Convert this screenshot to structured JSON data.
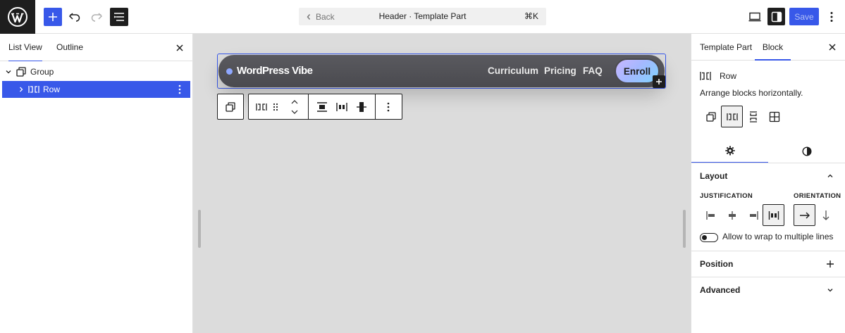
{
  "topbar": {
    "back_label": "Back",
    "document_title": "Header · Template Part",
    "shortcut": "⌘K",
    "save_label": "Save",
    "icons": [
      "wordpress-logo-icon",
      "plus-icon",
      "undo-icon",
      "redo-icon",
      "document-overview-icon",
      "desktop-view-icon",
      "settings-sidebar-icon",
      "options-icon"
    ]
  },
  "left_panel": {
    "tabs": [
      {
        "label": "List View",
        "active": true
      },
      {
        "label": "Outline",
        "active": false
      }
    ],
    "tree": [
      {
        "label": "Group",
        "icon": "group-icon",
        "expanded": true,
        "selected": false
      },
      {
        "label": "Row",
        "icon": "row-icon",
        "expanded": false,
        "selected": true
      }
    ]
  },
  "canvas": {
    "site_title": "WordPress Vibe",
    "nav_links": [
      "Curriculum",
      "Pricing",
      "FAQ"
    ],
    "cta_label": "Enroll"
  },
  "right_panel": {
    "tabs": [
      {
        "label": "Template Part",
        "active": false
      },
      {
        "label": "Block",
        "active": true
      }
    ],
    "block_name": "Row",
    "block_description": "Arrange blocks horizontally.",
    "variations": [
      "group-icon",
      "row-icon",
      "stack-icon",
      "grid-icon"
    ],
    "active_variation": "row-icon",
    "layout": {
      "title": "Layout",
      "justification_label": "Justification",
      "orientation_label": "Orientation",
      "justification_options": [
        "justify-left-icon",
        "justify-center-icon",
        "justify-right-icon",
        "justify-space-between-icon"
      ],
      "justification_selected": "justify-space-between-icon",
      "orientation_options": [
        "arrow-right-icon",
        "arrow-down-icon"
      ],
      "orientation_selected": "arrow-right-icon",
      "wrap_label": "Allow to wrap to multiple lines",
      "wrap_enabled": false
    },
    "position_title": "Position",
    "advanced_title": "Advanced"
  },
  "colors": {
    "accent": "#3858e9",
    "dark": "#1e1e1e",
    "canvas_bg": "#dcdcdc"
  }
}
